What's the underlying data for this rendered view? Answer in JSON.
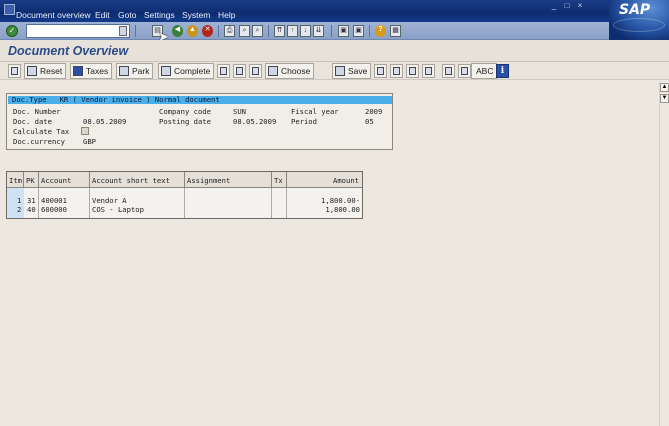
{
  "menu": {
    "items": [
      "Document overview",
      "Edit",
      "Goto",
      "Settings",
      "System",
      "Help"
    ]
  },
  "branding": {
    "logo_text": "SAP"
  },
  "toolbar": {
    "command_value": "",
    "icons": [
      "ok-icon",
      "save-icon",
      "back-icon",
      "exit-icon",
      "cancel-icon",
      "print-icon",
      "find-icon",
      "find-next-icon",
      "first-page-icon",
      "prev-page-icon",
      "next-page-icon",
      "last-page-icon",
      "new-session-icon",
      "shortcut-icon",
      "help-icon",
      "layout-icon"
    ]
  },
  "page": {
    "title": "Document Overview"
  },
  "app_toolbar": {
    "reset": "Reset",
    "taxes": "Taxes",
    "park": "Park",
    "complete": "Complete",
    "choose": "Choose",
    "save": "Save",
    "abc": "ABC"
  },
  "header": {
    "doc_type_line": "Doc.Type   KR ( Vendor invoice ) Normal document",
    "doc_number_label": "Doc. Number",
    "company_code_label": "Company code",
    "company_code_value": "SUN",
    "fiscal_year_label": "Fiscal year",
    "fiscal_year_value": "2009",
    "doc_date_label": "Doc. date",
    "doc_date_value": "08.05.2009",
    "posting_date_label": "Posting date",
    "posting_date_value": "08.05.2009",
    "period_label": "Period",
    "period_value": "05",
    "calculate_tax_label": "Calculate Tax",
    "doc_currency_label": "Doc.currency",
    "doc_currency_value": "GBP"
  },
  "items_table": {
    "columns": [
      "Itm",
      "PK",
      "Account",
      "Account short text",
      "Assignment",
      "Tx",
      "Amount"
    ],
    "rows": [
      {
        "itm": "1",
        "pk": "31",
        "account": "400001",
        "short_text": "Vendor A",
        "assignment": "",
        "tx": "",
        "amount": "1,800.00-"
      },
      {
        "itm": "2",
        "pk": "40",
        "account": "600000",
        "short_text": "COS - Laptop",
        "assignment": "",
        "tx": "",
        "amount": "1,800.00"
      }
    ]
  },
  "colors": {
    "menubar": "#0e2c70",
    "title": "#2c4c86",
    "header_bar": "#4aaee8",
    "background": "#ece8e0"
  }
}
